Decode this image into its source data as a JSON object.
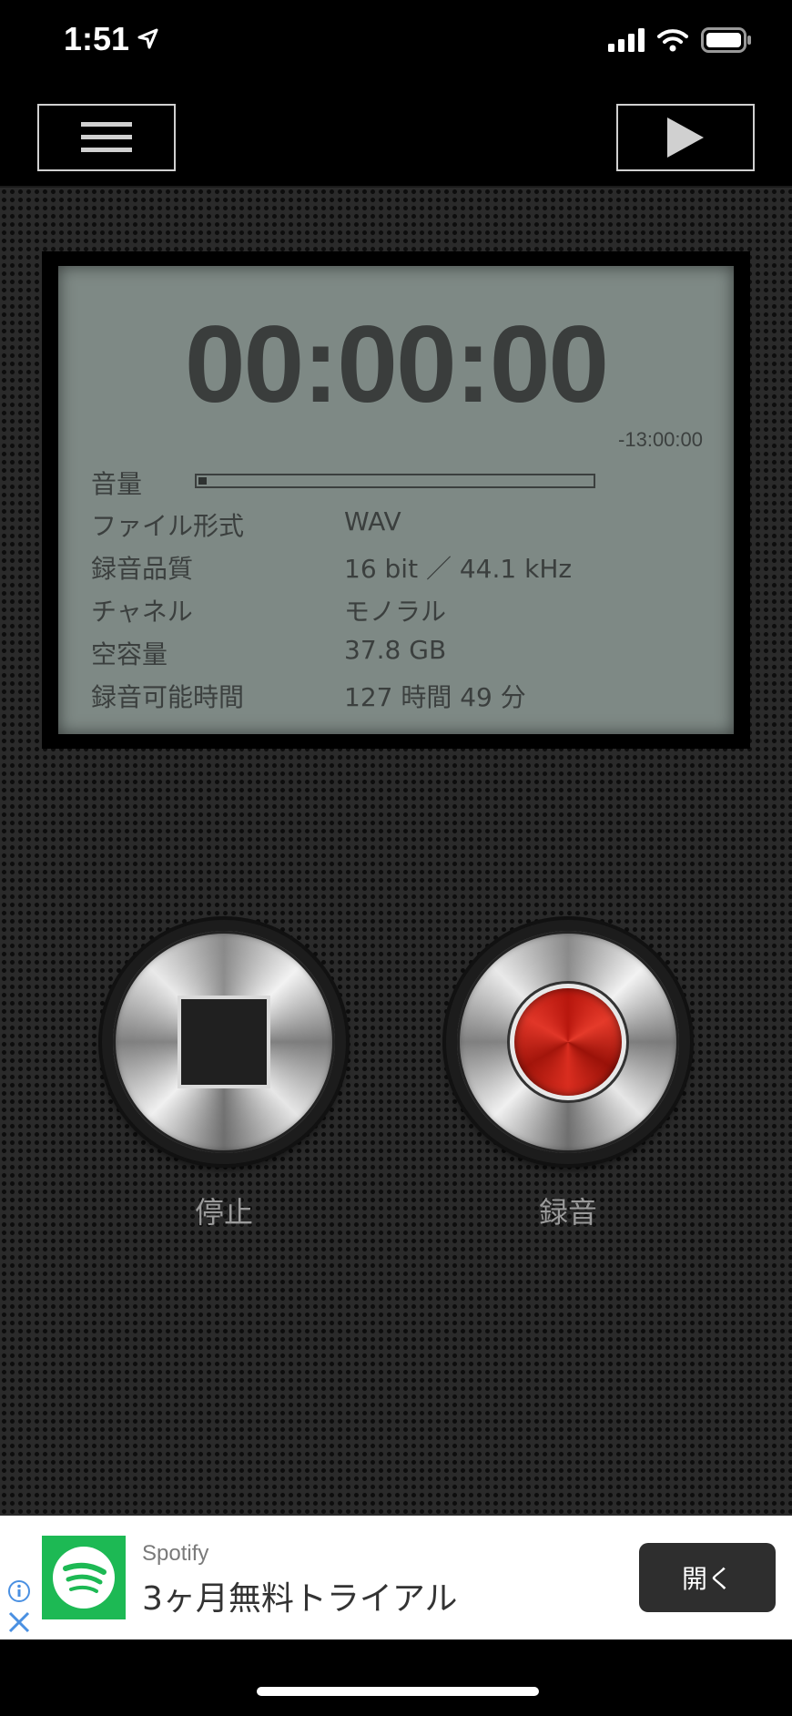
{
  "status_bar": {
    "time": "1:51"
  },
  "toolbar": {
    "menu_icon": "hamburger-icon",
    "play_icon": "play-icon"
  },
  "lcd": {
    "counter": "00:00:00",
    "remaining": "-13:00:00",
    "volume_label": "音量",
    "volume_level": 0.02,
    "rows": [
      {
        "label": "ファイル形式",
        "value": "WAV"
      },
      {
        "label": "録音品質",
        "value": "16 bit ／ 44.1 kHz"
      },
      {
        "label": "チャネル",
        "value": "モノラル"
      },
      {
        "label": "空容量",
        "value": "37.8 GB"
      },
      {
        "label": "録音可能時間",
        "value": "127 時間 49 分"
      }
    ]
  },
  "controls": {
    "stop_label": "停止",
    "record_label": "録音",
    "record_color": "#d8291c"
  },
  "ad": {
    "brand": "Spotify",
    "title": "3ヶ月無料トライアル",
    "cta": "開く",
    "brand_color": "#1db954"
  }
}
